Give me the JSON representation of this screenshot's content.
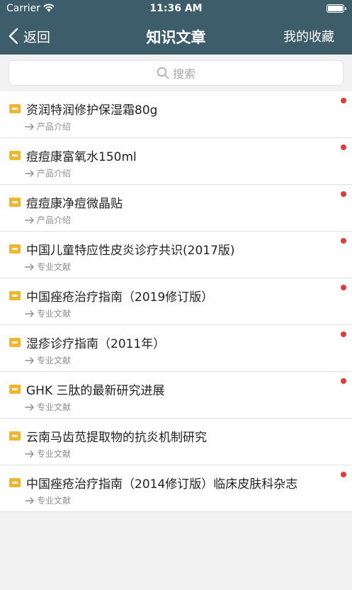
{
  "status_bar": {
    "carrier": "Carrier",
    "time": "11:36 AM"
  },
  "nav": {
    "back_label": "返回",
    "title": "知识文章",
    "right_label": "我的收藏"
  },
  "search": {
    "placeholder": "搜索"
  },
  "colors": {
    "header_bg": "#3d5d6b",
    "icon_yellow": "#f0b62d",
    "unread_dot": "#e03a3a"
  },
  "articles": [
    {
      "title": "资润特润修护保湿霜80g",
      "category": "产品介绍",
      "unread": true
    },
    {
      "title": "痘痘康富氧水150ml",
      "category": "产品介绍",
      "unread": true
    },
    {
      "title": "痘痘康净痘微晶贴",
      "category": "产品介绍",
      "unread": true
    },
    {
      "title": "中国儿童特应性皮炎诊疗共识(2017版)",
      "category": "专业文献",
      "unread": true
    },
    {
      "title": "中国痤疮治疗指南（2019修订版）",
      "category": "专业文献",
      "unread": true
    },
    {
      "title": "湿疹诊疗指南（2011年）",
      "category": "专业文献",
      "unread": true
    },
    {
      "title": "GHK 三肽的最新研究进展",
      "category": "专业文献",
      "unread": true
    },
    {
      "title": "云南马齿苋提取物的抗炎机制研究",
      "category": "专业文献",
      "unread": false
    },
    {
      "title": "中国痤疮治疗指南（2014修订版）临床皮肤科杂志",
      "category": "专业文献",
      "unread": true
    }
  ]
}
